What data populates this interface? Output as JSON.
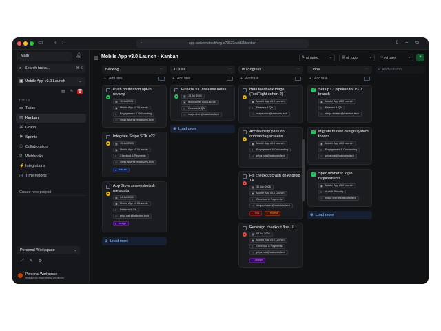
{
  "browser": {
    "url": "app.taskview.tech/org-e73523aa/d3f/kanban"
  },
  "sidebar": {
    "workspace_select": "Main",
    "search_label": "Search tasks...",
    "search_shortcut": "⌘ K",
    "project_select": "Mobile App v3.0 Launch",
    "section_label": "TOOLS",
    "nav": [
      {
        "label": "Tasks",
        "icon": "list-icon"
      },
      {
        "label": "Kanban",
        "icon": "kanban-icon",
        "active": true
      },
      {
        "label": "Graph",
        "icon": "graph-icon"
      },
      {
        "label": "Sprints",
        "icon": "sprint-icon"
      },
      {
        "label": "Collaboration",
        "icon": "users-icon"
      },
      {
        "label": "Webhooks",
        "icon": "webhook-icon"
      },
      {
        "label": "Integrations",
        "icon": "plug-icon"
      },
      {
        "label": "Time reports",
        "icon": "clock-icon"
      }
    ],
    "create_project": "Create new project",
    "workspace_footer": "Personal Workspace",
    "user_name": "Personal Workspace",
    "user_email": "m9kdkm@25fayrruthelsp.gmail.com"
  },
  "header": {
    "title": "Mobile App v3.0 Launch - Kanban",
    "filter_tasks": "All tasks",
    "filter_todo": "All ToDo",
    "filter_users": "All users"
  },
  "board": {
    "add_task_label": "Add task",
    "add_column_label": "Add column",
    "load_more_label": "Load more",
    "columns": [
      {
        "name": "Backlog",
        "cards": [
          {
            "title": "Push notification opt-in revamp",
            "priority_color": "#22c55e",
            "date": "11 Jul 2026",
            "project": "Mobile App v3.0 Launch",
            "group": "Engagement & Onboarding",
            "assignee": "diego.alvarez@taskview.tech",
            "tags": []
          },
          {
            "title": "Integrate Stripe SDK v22",
            "priority_color": "#eab308",
            "date": "10 Jul 2026",
            "project": "Mobile App v3.0 Launch",
            "group": "Checkout & Payments",
            "assignee": "diego.alvarez@taskview.tech",
            "tags": [
              {
                "label": "feature",
                "color": "#60a5fa"
              }
            ]
          },
          {
            "title": "App Store screenshots & metadata",
            "priority_color": "#eab308",
            "date": "04 Jul 2026",
            "project": "Mobile App v3.0 Launch",
            "group": "Release & QA",
            "assignee": "priya.nair@taskview.tech",
            "tags": [
              {
                "label": "design",
                "color": "#c084fc"
              }
            ]
          }
        ]
      },
      {
        "name": "TODO",
        "cards": [
          {
            "title": "Finalize v3.0 release notes",
            "priority_color": "#22c55e",
            "date": "15 Jul 2026",
            "project": "Mobile App v3.0 Launch",
            "group": "Release & QA",
            "assignee": "maya.chen@taskview.tech",
            "tags": []
          }
        ]
      },
      {
        "name": "In Progress",
        "cards": [
          {
            "title": "Beta feedback triage (TestFlight cohort 2)",
            "priority_color": "#eab308",
            "date": "",
            "project": "Mobile App v3.0 Launch",
            "group": "Release & QA",
            "assignee": "maya.chen@taskview.tech",
            "tags": []
          },
          {
            "title": "Accessibility pass on onboarding screens",
            "priority_color": "#eab308",
            "date": "",
            "project": "Mobile App v3.0 Launch",
            "group": "Engagement & Onboarding",
            "assignee": "priya.nair@taskview.tech",
            "tags": []
          },
          {
            "title": "Fix checkout crash on Android 14",
            "priority_color": "#ef4444",
            "date": "30 Jun 2026",
            "project": "Mobile App v3.0 Launch",
            "group": "Checkout & Payments",
            "assignee": "diego.alvarez@taskview.tech",
            "tags": [
              {
                "label": "bug",
                "color": "#f87171"
              },
              {
                "label": "urgent",
                "color": "#fb923c"
              }
            ]
          },
          {
            "title": "Redesign checkout flow UI",
            "priority_color": "#ef4444",
            "date": "03 Jul 2026",
            "project": "Mobile App v3.0 Launch",
            "group": "Checkout & Payments",
            "assignee": "priya.nair@taskview.tech",
            "tags": [
              {
                "label": "design",
                "color": "#c084fc"
              }
            ]
          }
        ]
      },
      {
        "name": "Done",
        "cards": [
          {
            "title": "Set up CI pipeline for v3.0 branch",
            "done": true,
            "date": "",
            "project": "Mobile App v3.0 Launch",
            "group": "Release & QA",
            "assignee": "diego.alvarez@taskview.tech",
            "tags": []
          },
          {
            "title": "Migrate to new design system tokens",
            "done": true,
            "date": "",
            "project": "Mobile App v3.0 Launch",
            "group": "Engagement & Onboarding",
            "assignee": "priya.nair@taskview.tech",
            "tags": []
          },
          {
            "title": "Spec biometric login requirements",
            "done": true,
            "date": "",
            "project": "Mobile App v3.0 Launch",
            "group": "Auth & Security",
            "assignee": "maya.chen@taskview.tech",
            "tags": []
          }
        ]
      }
    ]
  }
}
